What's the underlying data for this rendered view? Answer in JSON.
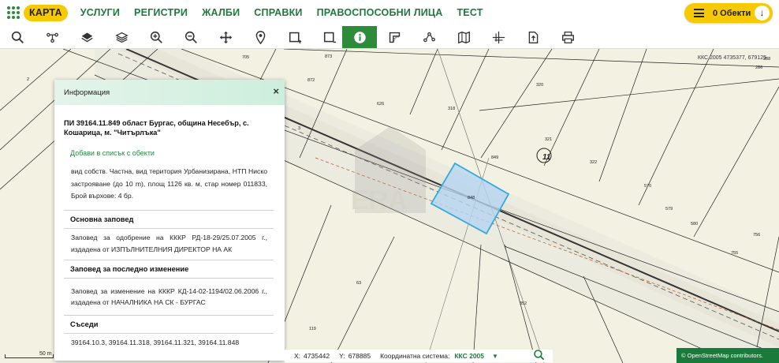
{
  "nav": {
    "items": [
      "КАРТА",
      "УСЛУГИ",
      "РЕГИСТРИ",
      "ЖАЛБИ",
      "СПРАВКИ",
      "ПРАВОСПОСОБНИ ЛИЦА",
      "ТЕСТ"
    ],
    "active_index": 0
  },
  "objects_button": {
    "label": "0 Обекти"
  },
  "toolbar": {
    "tools": [
      "search",
      "layers-tree",
      "layer-stack",
      "layers",
      "zoom-in",
      "zoom-out",
      "pan",
      "marker",
      "select-rect",
      "select-rect-alt",
      "info",
      "measure",
      "geometry",
      "map",
      "crosshair",
      "export",
      "print"
    ],
    "active": "info"
  },
  "map": {
    "coordinate_readout": "ККС 2005 4735377, 679125",
    "parcel_labels": [
      "705",
      "873",
      "872",
      "626",
      "318",
      "320",
      "321",
      "322",
      "849",
      "11",
      "848",
      "570",
      "579",
      "580",
      "755",
      "756",
      "352",
      "63",
      "119",
      "2",
      "3",
      "286",
      "288"
    ]
  },
  "panel": {
    "header": "Информация",
    "close": "×",
    "title": "ПИ 39164.11.849 област Бургас, община Несебър, с. Кошарица, м. \"Читърлъка\"",
    "add_link": "Добави в списък с обекти",
    "description": "вид собств. Частна, вид територия Урбанизирана, НТП Ниско застрояване (до 10 m), площ 1126 кв. м, стар номер 011833, Брой върхове: 4 бр.",
    "sections": [
      {
        "heading": "Основна заповед",
        "text": "Заповед за одобрение на КККР РД-18-29/25.07.2005 г., издадена от ИЗПЪЛНИТЕЛНИЯ ДИРЕКТОР НА АК"
      },
      {
        "heading": "Заповед за последно изменение",
        "text": "Заповед за изменение на КККР КД-14-02-1194/02.06.2006 г., издадена от НАЧАЛНИКА НА СК - БУРГАС"
      },
      {
        "heading": "Съседи",
        "text": "39164.10.3, 39164.11.318, 39164.11.321, 39164.11.848"
      }
    ]
  },
  "status": {
    "scale": "50 m",
    "x_label": "X:",
    "x_value": "4735442",
    "y_label": "Y:",
    "y_value": "678885",
    "coord_system_label": "Координатна система:",
    "coord_system_value": "ККС 2005",
    "attribution": "© OpenStreetMap contributors."
  },
  "colors": {
    "brand_green": "#1f7a3c",
    "accent_yellow": "#f6c900",
    "highlight": "#33aadd"
  }
}
